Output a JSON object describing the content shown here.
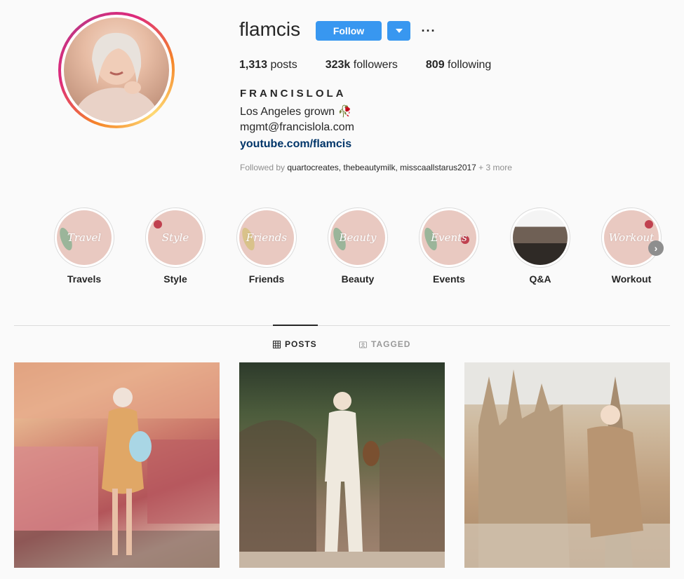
{
  "profile": {
    "username": "flamcis",
    "follow_label": "Follow",
    "more_glyph": "···",
    "stats": [
      {
        "value": "1,313",
        "label": " posts"
      },
      {
        "value": "323k",
        "label": " followers"
      },
      {
        "value": "809",
        "label": " following"
      }
    ],
    "full_name": "FRANCISLOLA",
    "bio_line1": "Los Angeles grown 🥀",
    "bio_line2": "mgmt@francislola.com",
    "bio_link": "youtube.com/flamcis",
    "followed_by_prefix": "Followed by ",
    "followed_by_accounts": "quartocreates, thebeautymilk, misscaallstarus2017",
    "followed_by_more": " + 3 more"
  },
  "highlights": [
    {
      "label": "Travels",
      "script": "Travel"
    },
    {
      "label": "Style",
      "script": "Style"
    },
    {
      "label": "Friends",
      "script": "Friends"
    },
    {
      "label": "Beauty",
      "script": "Beauty"
    },
    {
      "label": "Events",
      "script": "Events"
    },
    {
      "label": "Q&A",
      "script": ""
    },
    {
      "label": "Workout",
      "script": "Workout"
    }
  ],
  "tabs": {
    "posts": "POSTS",
    "tagged": "TAGGED"
  },
  "colors": {
    "accent": "#3897f0",
    "link": "#003569",
    "muted": "#8e8e8e"
  }
}
